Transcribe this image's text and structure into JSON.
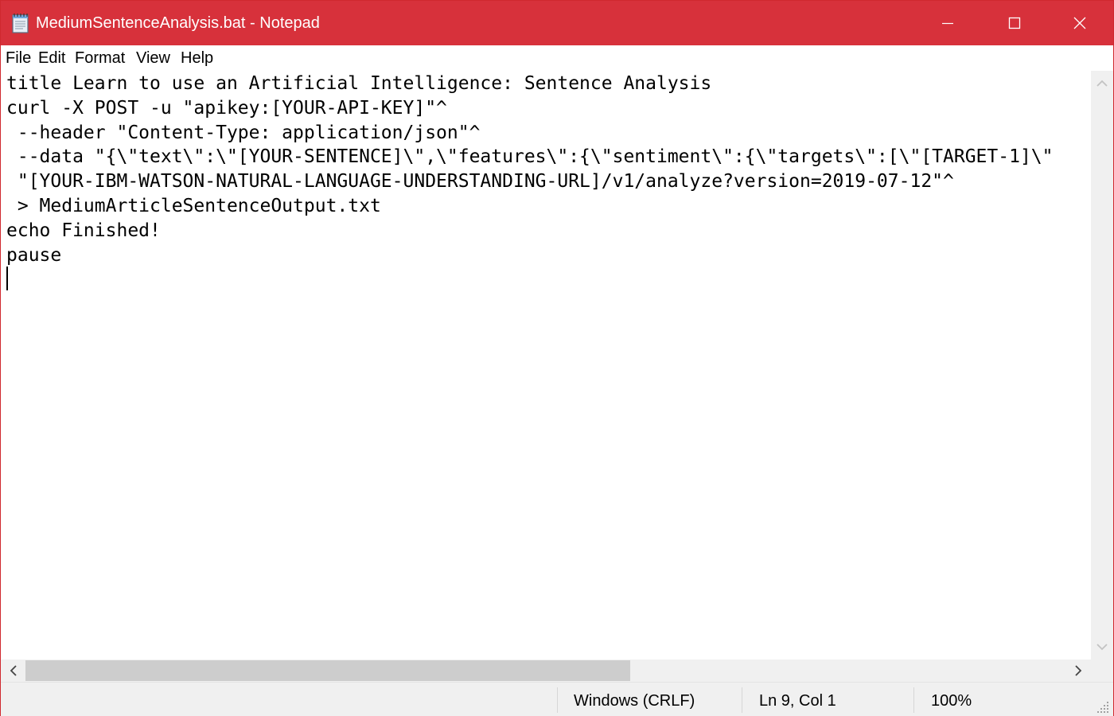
{
  "window": {
    "title": "MediumSentenceAnalysis.bat - Notepad",
    "title_bar_color": "#d7313b",
    "icons": {
      "app": "notepad-icon",
      "minimize": "minimize-icon",
      "maximize": "maximize-icon",
      "close": "close-icon"
    }
  },
  "menu": {
    "items": [
      {
        "label": "File"
      },
      {
        "label": "Edit"
      },
      {
        "label": "Format"
      },
      {
        "label": "View"
      },
      {
        "label": "Help"
      }
    ]
  },
  "editor": {
    "lines": [
      "title Learn to use an Artificial Intelligence: Sentence Analysis",
      "curl -X POST -u \"apikey:[YOUR-API-KEY]\"^",
      " --header \"Content-Type: application/json\"^",
      " --data \"{\\\"text\\\":\\\"[YOUR-SENTENCE]\\\",\\\"features\\\":{\\\"sentiment\\\":{\\\"targets\\\":[\\\"[TARGET-1]\\\"",
      " \"[YOUR-IBM-WATSON-NATURAL-LANGUAGE-UNDERSTANDING-URL]/v1/analyze?version=2019-07-12\"^",
      " > MediumArticleSentenceOutput.txt",
      "echo Finished!",
      "pause",
      ""
    ]
  },
  "scrollbars": {
    "icons": {
      "up": "chevron-up-icon",
      "down": "chevron-down-icon",
      "left": "chevron-left-icon",
      "right": "chevron-right-icon"
    }
  },
  "status": {
    "line_ending": "Windows (CRLF)",
    "position": "Ln 9, Col 1",
    "zoom": "100%"
  }
}
